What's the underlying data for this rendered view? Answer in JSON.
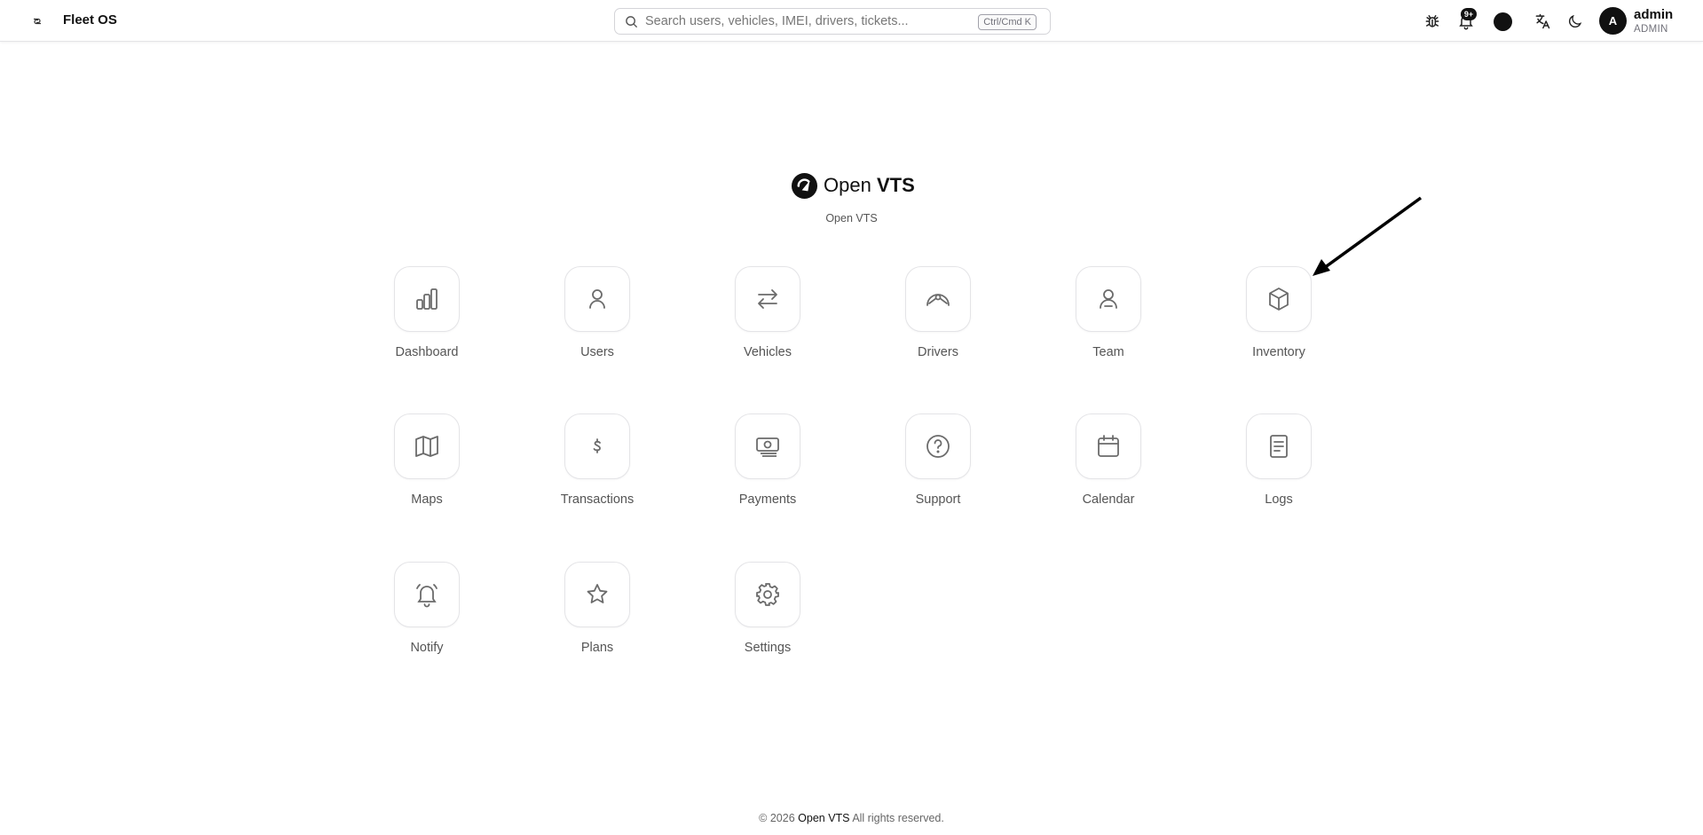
{
  "header": {
    "app_name": "Fleet OS",
    "search": {
      "placeholder": "Search users, vehicles, IMEI, drivers, tickets...",
      "value": "",
      "shortcut": "Ctrl/Cmd K"
    },
    "notification_badge": "9+",
    "user": {
      "initial": "A",
      "name": "admin",
      "role": "ADMIN"
    },
    "icons": [
      "menu-icon",
      "search-icon",
      "bug-icon",
      "bell-icon",
      "theme-dot",
      "translate-icon",
      "moon-icon"
    ]
  },
  "brand": {
    "logo_text_regular": "Open",
    "logo_text_bold": "VTS",
    "subtitle": "Open VTS"
  },
  "apps": [
    {
      "label": "Dashboard",
      "icon": "bar-chart"
    },
    {
      "label": "Users",
      "icon": "user"
    },
    {
      "label": "Vehicles",
      "icon": "arrows-left-right"
    },
    {
      "label": "Drivers",
      "icon": "steering"
    },
    {
      "label": "Team",
      "icon": "team"
    },
    {
      "label": "Inventory",
      "icon": "box"
    },
    {
      "label": "Maps",
      "icon": "map"
    },
    {
      "label": "Transactions",
      "icon": "currency"
    },
    {
      "label": "Payments",
      "icon": "banknote"
    },
    {
      "label": "Support",
      "icon": "help-circle"
    },
    {
      "label": "Calendar",
      "icon": "calendar"
    },
    {
      "label": "Logs",
      "icon": "file-text"
    },
    {
      "label": "Notify",
      "icon": "bell-ring"
    },
    {
      "label": "Plans",
      "icon": "star"
    },
    {
      "label": "Settings",
      "icon": "gear"
    }
  ],
  "annotation": {
    "type": "arrow",
    "points_to": "Inventory"
  },
  "footer": {
    "copyright": "© 2026",
    "brand": "Open VTS",
    "rights": "All rights reserved."
  },
  "colors": {
    "text": "#111111",
    "muted": "#555555",
    "border": "#e4e4e7",
    "icon": "#6b6b6b"
  }
}
